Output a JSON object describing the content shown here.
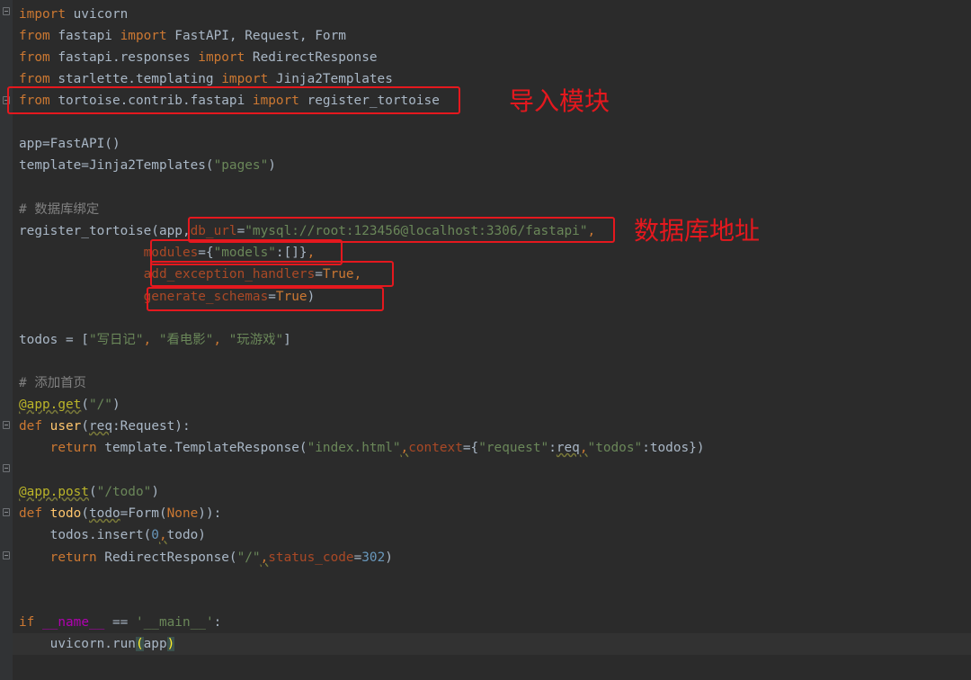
{
  "annotations": {
    "import_module": "导入模块",
    "db_address": "数据库地址"
  },
  "code": {
    "l1": {
      "kw": "import",
      "mod": " uvicorn"
    },
    "l2": {
      "kw1": "from",
      "mod": " fastapi ",
      "kw2": "import",
      "names": " FastAPI, Request, Form"
    },
    "l3": {
      "kw1": "from",
      "mod": " fastapi.responses ",
      "kw2": "import",
      "names": " RedirectResponse"
    },
    "l4": {
      "kw1": "from",
      "mod": " starlette.templating ",
      "kw2": "import",
      "names": " Jinja2Templates"
    },
    "l5": {
      "kw1": "from",
      "mod": " tortoise.contrib.fastapi ",
      "kw2": "import",
      "names": " register_tortoise"
    },
    "l6": {
      "text": "app=FastAPI()"
    },
    "l7": {
      "a": "template=Jinja2Templates(",
      "s": "\"pages\"",
      "b": ")"
    },
    "l8": {
      "comment": "# 数据库绑定"
    },
    "l9": {
      "a": "register_tortoise(app,",
      "p": "db_url",
      "eq": "=",
      "s": "\"mysql://root:123456@localhost:3306/fastapi\"",
      "comma": ","
    },
    "l10": {
      "indent": "                ",
      "p": "modules",
      "a": "={",
      "s": "\"models\"",
      "b": ":[]}",
      "comma": ","
    },
    "l11": {
      "indent": "                ",
      "p": "add_exception_handlers",
      "eq": "=",
      "k": "True",
      "comma": ","
    },
    "l12": {
      "indent": "                ",
      "p": "generate_schemas",
      "eq": "=",
      "k": "True",
      "b": ")"
    },
    "l13": {
      "a": "todos = [",
      "s1": "\"写日记\"",
      "c1": ", ",
      "s2": "\"看电影\"",
      "c2": ", ",
      "s3": "\"玩游戏\"",
      "b": "]"
    },
    "l14": {
      "comment": "# 添加首页"
    },
    "l15": {
      "dec": "@app.get",
      "a": "(",
      "s": "\"/\"",
      "b": ")"
    },
    "l16": {
      "kw": "def",
      "sp": " ",
      "fn": "user",
      "a": "(",
      "w": "req",
      "b": ":Request):"
    },
    "l17": {
      "indent": "    ",
      "kw": "return",
      "a": " template.TemplateResponse(",
      "s1": "\"index.html\"",
      "c1": ",",
      "p": "context",
      "b": "={",
      "s2": "\"request\"",
      "c": ":",
      "w": "req",
      "c2": ",",
      "s3": "\"todos\"",
      "d": ":todos})"
    },
    "l18": {
      "dec": "@app.post",
      "a": "(",
      "s": "\"/todo\"",
      "b": ")"
    },
    "l19": {
      "kw": "def",
      "sp": " ",
      "fn": "todo",
      "a": "(",
      "w": "todo",
      "b": "=Form(",
      "k": "None",
      "c": ")):"
    },
    "l20": {
      "indent": "    ",
      "a": "todos.insert(",
      "n": "0",
      "c": ",",
      "b": "todo)"
    },
    "l21": {
      "indent": "    ",
      "kw": "return",
      "a": " RedirectResponse(",
      "s": "\"/\"",
      "c": ",",
      "p": "status_code",
      "eq": "=",
      "n": "302",
      "b": ")"
    },
    "l22": {
      "kw": "if",
      "sp": " ",
      "d1": "__name__",
      "a": " == ",
      "s": "'__main__'",
      "b": ":"
    },
    "l23": {
      "indent": "    ",
      "a": "uvicorn.run",
      "br1": "(",
      "arg": "app",
      "br2": ")"
    }
  }
}
